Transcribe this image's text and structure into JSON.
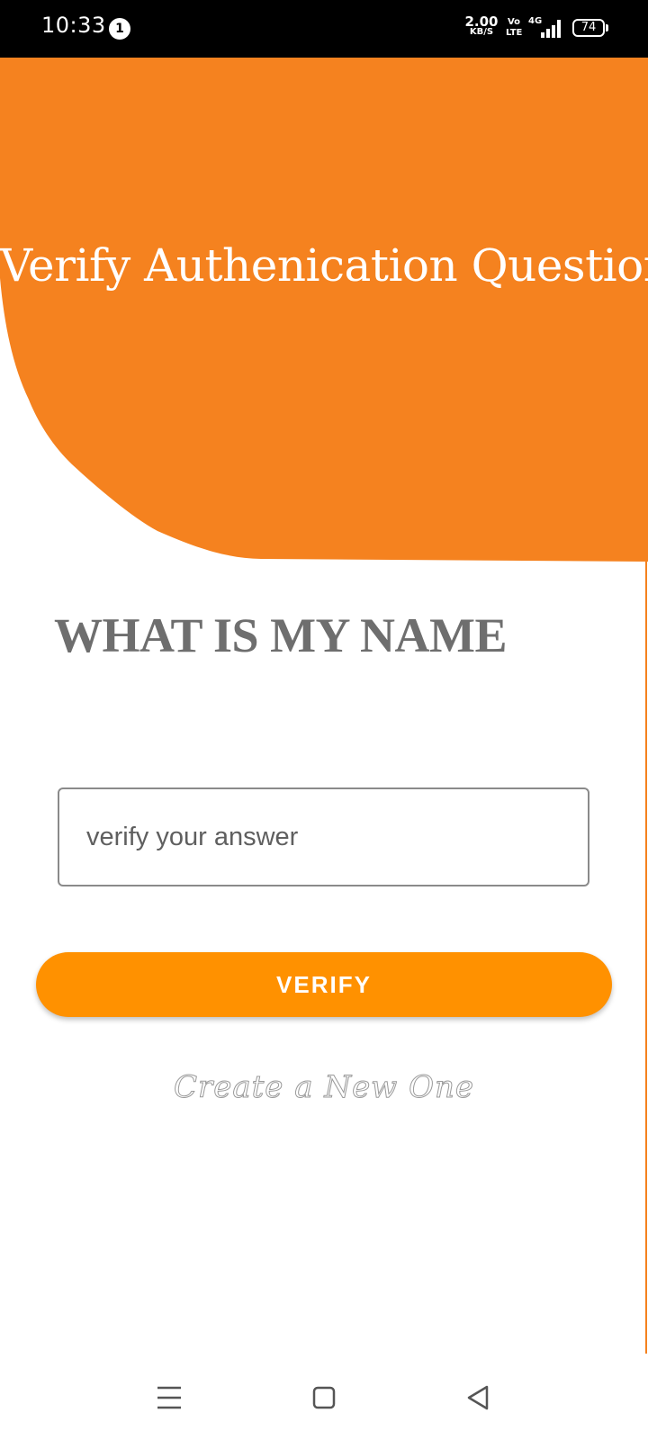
{
  "status_bar": {
    "time": "10:33",
    "notification_count": "1",
    "net_speed_value": "2.00",
    "net_speed_unit": "KB/S",
    "volte_top": "Vo",
    "volte_bottom": "LTE",
    "network_type": "4G",
    "battery_level": "74"
  },
  "header": {
    "title": "Verify Authenication Question",
    "color": "#f5821f"
  },
  "question": {
    "text": "WHAT IS MY NAME"
  },
  "answer_input": {
    "placeholder": "verify your answer",
    "value": ""
  },
  "verify_button": {
    "label": "VERIFY",
    "color": "#ff9100"
  },
  "create_link": {
    "label": "Create a New One"
  },
  "nav_bar": {
    "icons": [
      "menu-icon",
      "home-icon",
      "back-icon"
    ]
  }
}
